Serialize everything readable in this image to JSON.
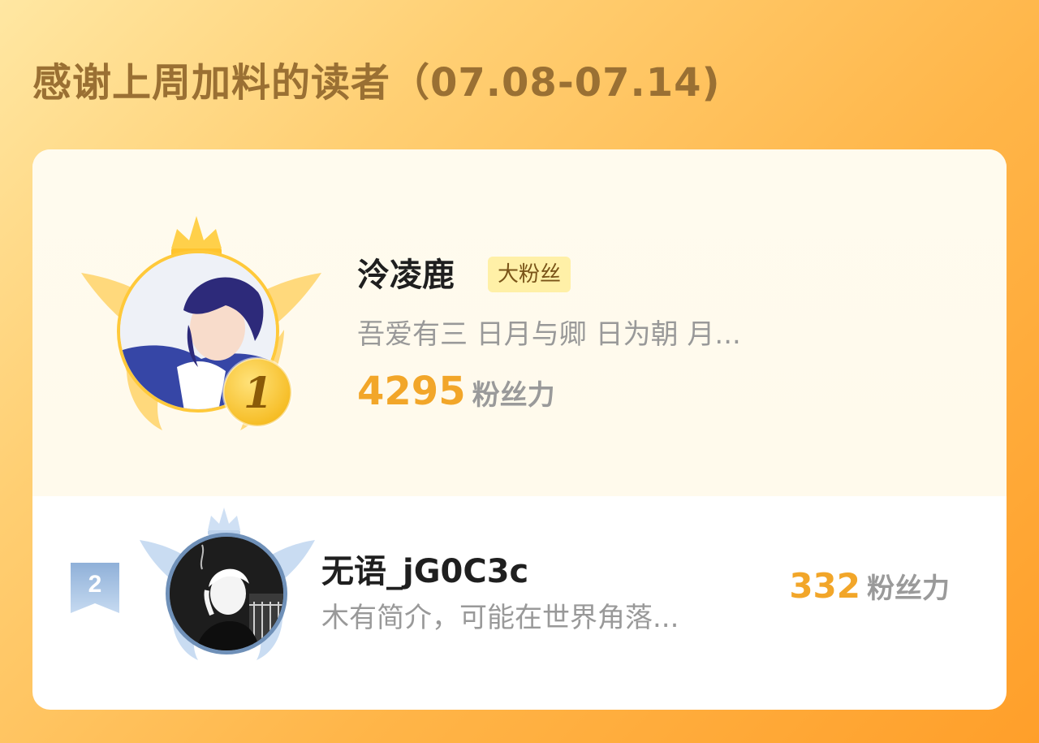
{
  "header": {
    "title": "感谢上周加料的读者（07.08-07.14)"
  },
  "readers": [
    {
      "rank": "1",
      "name": "泠凌鹿",
      "badge": "大粉丝",
      "bio": "吾爱有三 日月与卿 日为朝 月...",
      "score": "4295",
      "score_unit": "粉丝力"
    },
    {
      "rank": "2",
      "name": "无语_jG0C3c",
      "bio": "木有简介，可能在世界角落...",
      "score": "332",
      "score_unit": "粉丝力"
    }
  ],
  "colors": {
    "accent": "#f2a629",
    "title": "#9a7033",
    "gold": "#ffc93a",
    "silver_blue": "#6f90b8"
  },
  "icons": {
    "rank1": "gold-crown-wings-icon",
    "rank2": "silver-crown-wings-icon",
    "rank2_flag": "rank-ribbon-icon"
  }
}
